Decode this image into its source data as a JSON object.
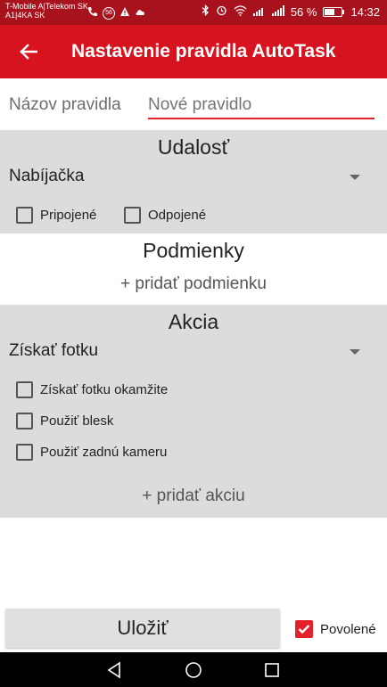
{
  "status_bar": {
    "carrier_line1": "T-Mobile A|Telekom SK",
    "carrier_line2": "A1|4KA SK",
    "badge": "56",
    "battery_text": "56 %",
    "time": "14:32",
    "battery_level": 0.56
  },
  "app_bar": {
    "title": "Nastavenie pravidla AutoTask",
    "back_icon": "arrow-left-icon"
  },
  "rule_name": {
    "label": "Názov pravidla",
    "placeholder": "Nové pravidlo",
    "value": ""
  },
  "event": {
    "title": "Udalosť",
    "selected": "Nabíjačka",
    "options": [
      {
        "label": "Pripojené",
        "checked": false
      },
      {
        "label": "Odpojené",
        "checked": false
      }
    ]
  },
  "conditions": {
    "title": "Podmienky",
    "add_label": "+ pridať podmienku"
  },
  "action": {
    "title": "Akcia",
    "selected": "Získať fotku",
    "options": [
      {
        "label": "Získať fotku okamžite",
        "checked": false
      },
      {
        "label": "Použiť blesk",
        "checked": false
      },
      {
        "label": "Použiť zadnú kameru",
        "checked": false
      }
    ],
    "add_label": "+ pridať akciu"
  },
  "footer": {
    "save_label": "Uložiť",
    "enabled_label": "Povolené",
    "enabled": true
  },
  "colors": {
    "status_bar": "#a8121c",
    "app_bar": "#d7131f",
    "accent": "#e3202b",
    "section_gray": "#dcdcdc"
  }
}
